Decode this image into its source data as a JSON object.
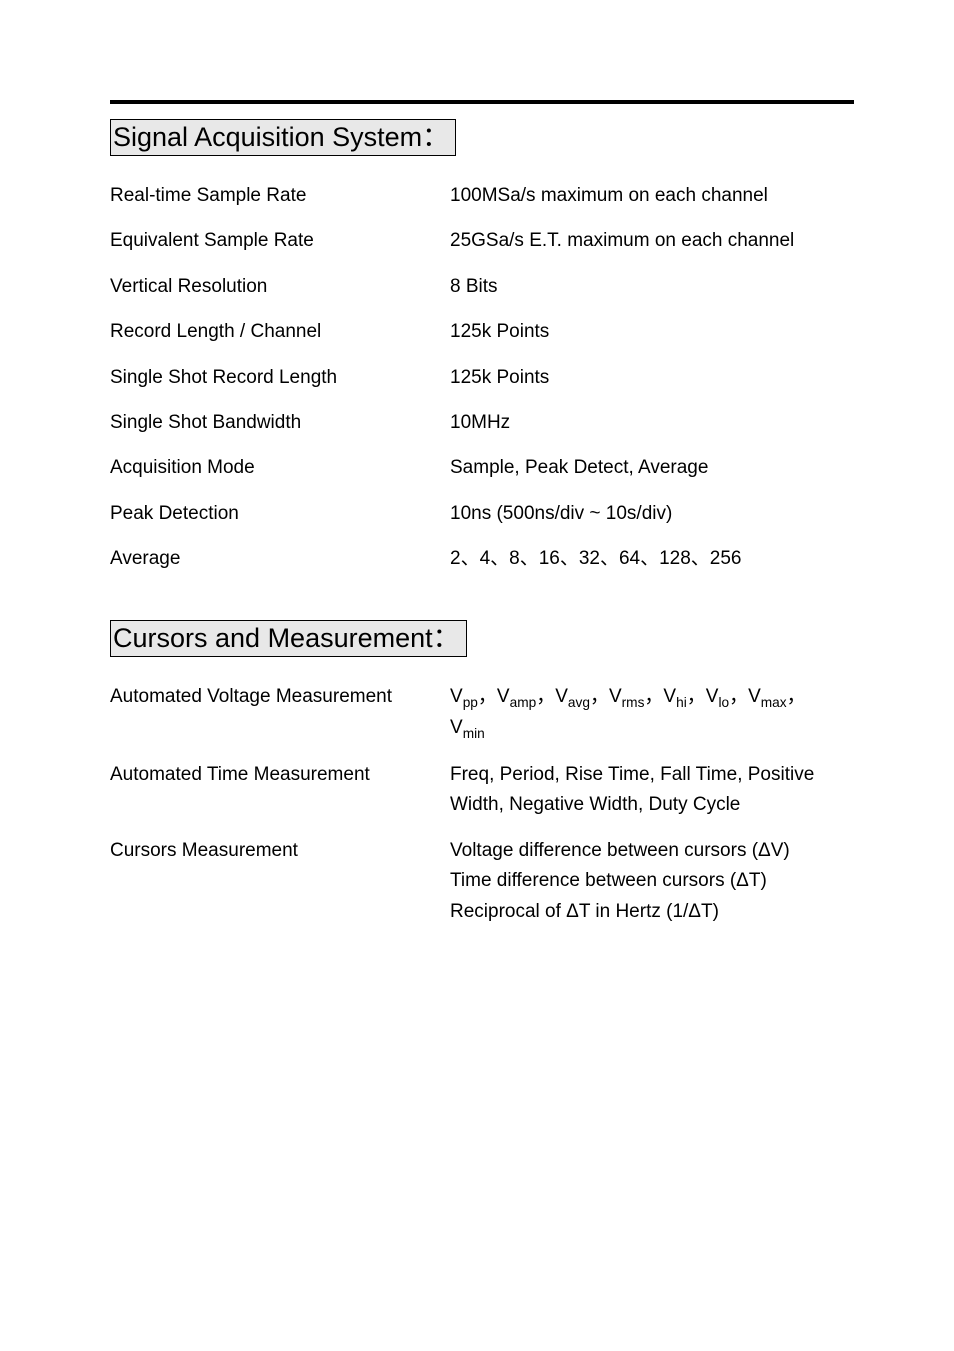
{
  "section1": {
    "title": "Signal Acquisition System：",
    "rows": [
      {
        "label": "Real-time Sample Rate",
        "value": "100MSa/s maximum on each channel"
      },
      {
        "label": "Equivalent Sample Rate",
        "value": "25GSa/s E.T. maximum on each channel"
      },
      {
        "label": "Vertical Resolution",
        "value": "8 Bits"
      },
      {
        "label": "Record Length / Channel",
        "value": "125k Points"
      },
      {
        "label": "Single Shot Record Length",
        "value": "125k Points"
      },
      {
        "label": "Single Shot Bandwidth",
        "value": "10MHz"
      },
      {
        "label": "Acquisition Mode",
        "value": "Sample, Peak Detect, Average"
      },
      {
        "label": "Peak Detection",
        "value": "10ns (500ns/div ~ 10s/div)"
      },
      {
        "label": "Average",
        "value": "2、4、8、16、32、64、128、256"
      }
    ]
  },
  "section2": {
    "title": "Cursors and Measurement：",
    "rows": [
      {
        "label": "Automated Voltage Measurement",
        "value_html": "V<sub>pp</sub>，V<sub>amp</sub>，V<sub>avg</sub>，V<sub>rms</sub>，V<sub>hi</sub>，V<sub>lo</sub>，V<sub>max</sub>，<br>V<sub>min</sub>"
      },
      {
        "label": "Automated Time Measurement",
        "value_html": "Freq, Period, Rise Time, Fall Time, Positive Width, Negative Width, Duty Cycle"
      },
      {
        "label": "Cursors Measurement",
        "value_html": "Voltage difference between cursors (ΔV)<br>Time difference between cursors (ΔT)<br>Reciprocal of ΔT in Hertz (1/ΔT)"
      }
    ]
  }
}
